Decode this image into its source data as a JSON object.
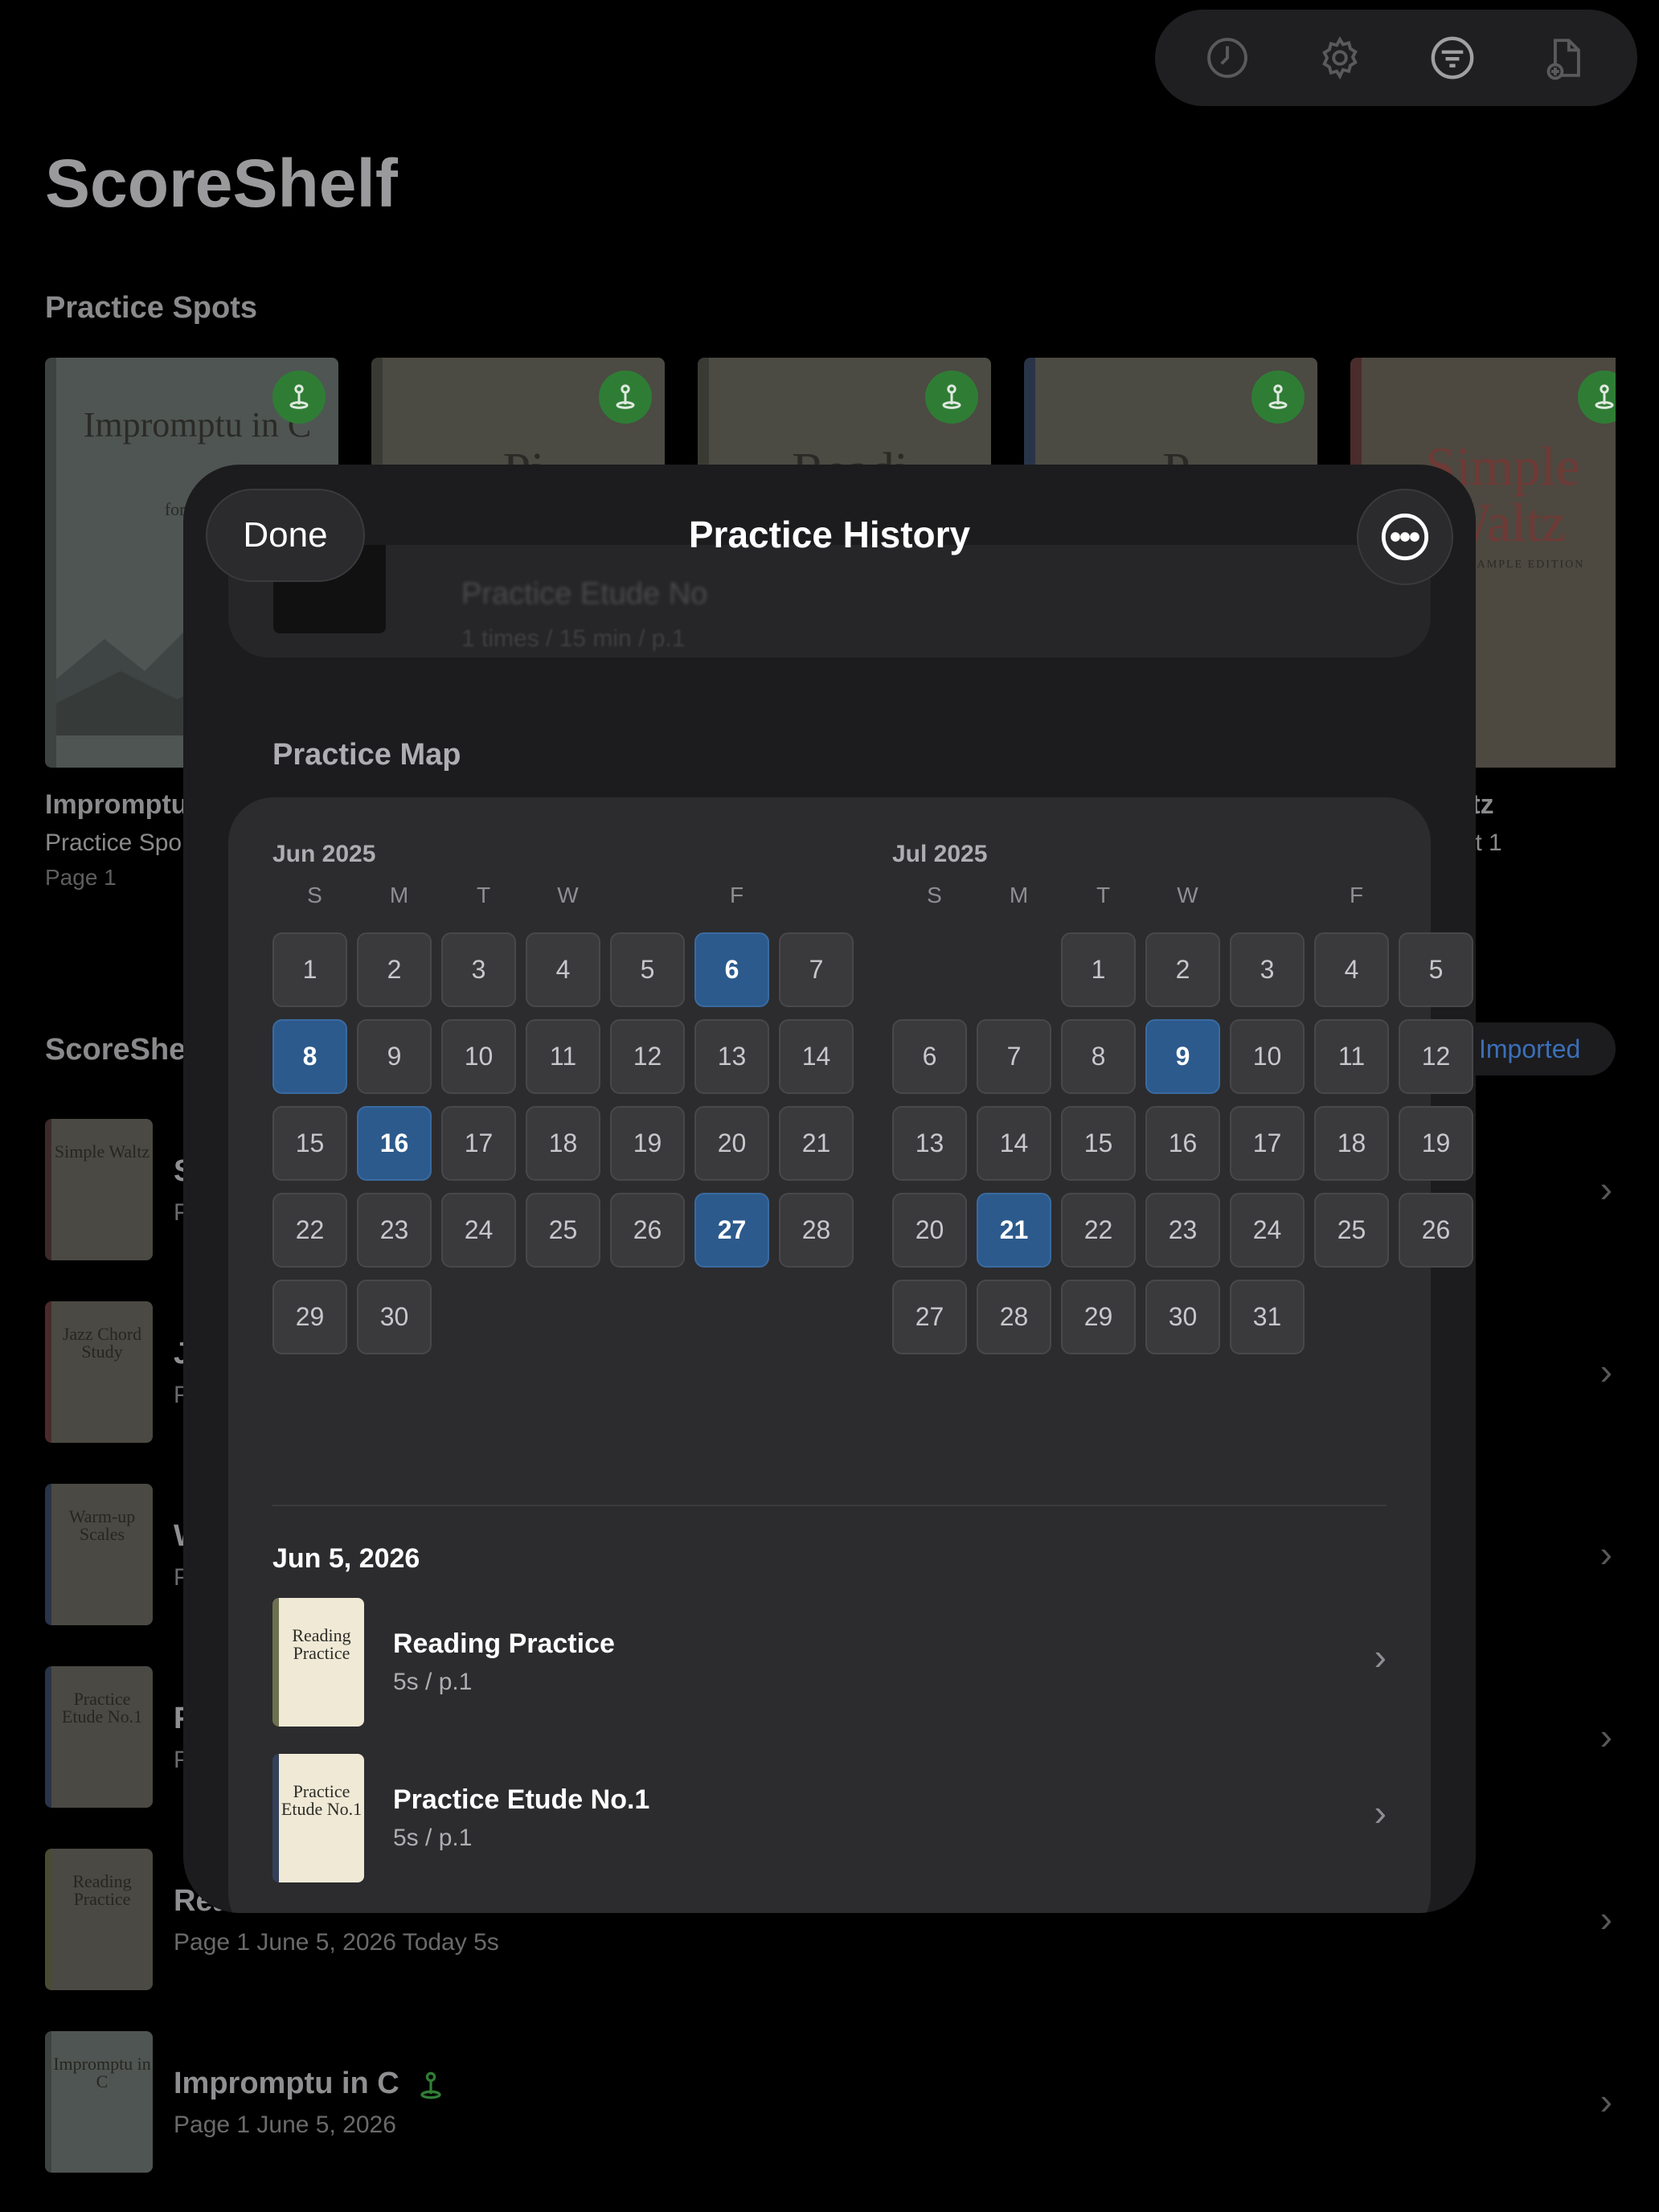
{
  "app_title": "ScoreShelf",
  "sections": {
    "spots": "Practice Spots",
    "shelf": "ScoreShe"
  },
  "toolbar": {
    "icons": [
      "clock-icon",
      "gear-icon",
      "filter-icon",
      "add-document-icon"
    ]
  },
  "spots": [
    {
      "cover_title": "Impromptu in C",
      "cover_sub": "for Piano",
      "caption_title": "Impromptu",
      "caption_sub": "Practice Spo",
      "caption_page": "Page 1"
    },
    {
      "cover_title": "Pi",
      "cover_sub": "",
      "caption_title": "",
      "caption_sub": "",
      "caption_page": ""
    },
    {
      "cover_title": "Readi",
      "cover_sub": "",
      "caption_title": "",
      "caption_sub": "",
      "caption_page": ""
    },
    {
      "cover_title": "P",
      "cover_sub": "",
      "caption_title": "",
      "caption_sub": "",
      "caption_page": ""
    },
    {
      "cover_title": "Simple Waltz",
      "cover_sub": "EARLY SAMPLE EDITION",
      "caption_title": "altz",
      "caption_sub": "pot 1",
      "caption_page": ""
    }
  ],
  "imported_filter": "Imported",
  "shelf_rows": [
    {
      "thumb": "Simple Waltz",
      "title": "S",
      "meta": "P"
    },
    {
      "thumb": "Jazz Chord Study",
      "title": "J",
      "meta": "P"
    },
    {
      "thumb": "Warm-up Scales",
      "title": "W",
      "meta": "P"
    },
    {
      "thumb": "Practice Etude No.1",
      "title": "P",
      "meta": "P"
    },
    {
      "thumb": "Reading Practice",
      "title": "Rea",
      "meta": "Page 1   June 5, 2026   Today 5s"
    },
    {
      "thumb": "Impromptu in C",
      "title": "Impromptu in C",
      "meta": "Page 1   June 5, 2026"
    }
  ],
  "modal": {
    "done_label": "Done",
    "title": "Practice History",
    "ghost_title": "Practice Etude No",
    "ghost_meta": "1 times / 15 min / p.1",
    "map_label": "Practice Map",
    "weekdays": [
      "S",
      "M",
      "T",
      "W",
      "",
      "F",
      ""
    ],
    "months": [
      {
        "label": "Jun 2025",
        "offset": 0,
        "days": 30,
        "highlighted": [
          6,
          8,
          16,
          27
        ]
      },
      {
        "label": "Jul 2025",
        "offset": 2,
        "days": 31,
        "highlighted": [
          9,
          21
        ]
      }
    ],
    "history_date": "Jun 5, 2026",
    "history": [
      {
        "thumb": "Reading Practice",
        "title": "Reading Practice",
        "meta": "5s / p.1"
      },
      {
        "thumb": "Practice Etude No.1",
        "title": "Practice Etude No.1",
        "meta": "5s / p.1"
      }
    ]
  },
  "colors": {
    "highlight": "#2c5a8c",
    "pin_green": "#2f7d35",
    "modal_bg": "#1c1c1e"
  }
}
